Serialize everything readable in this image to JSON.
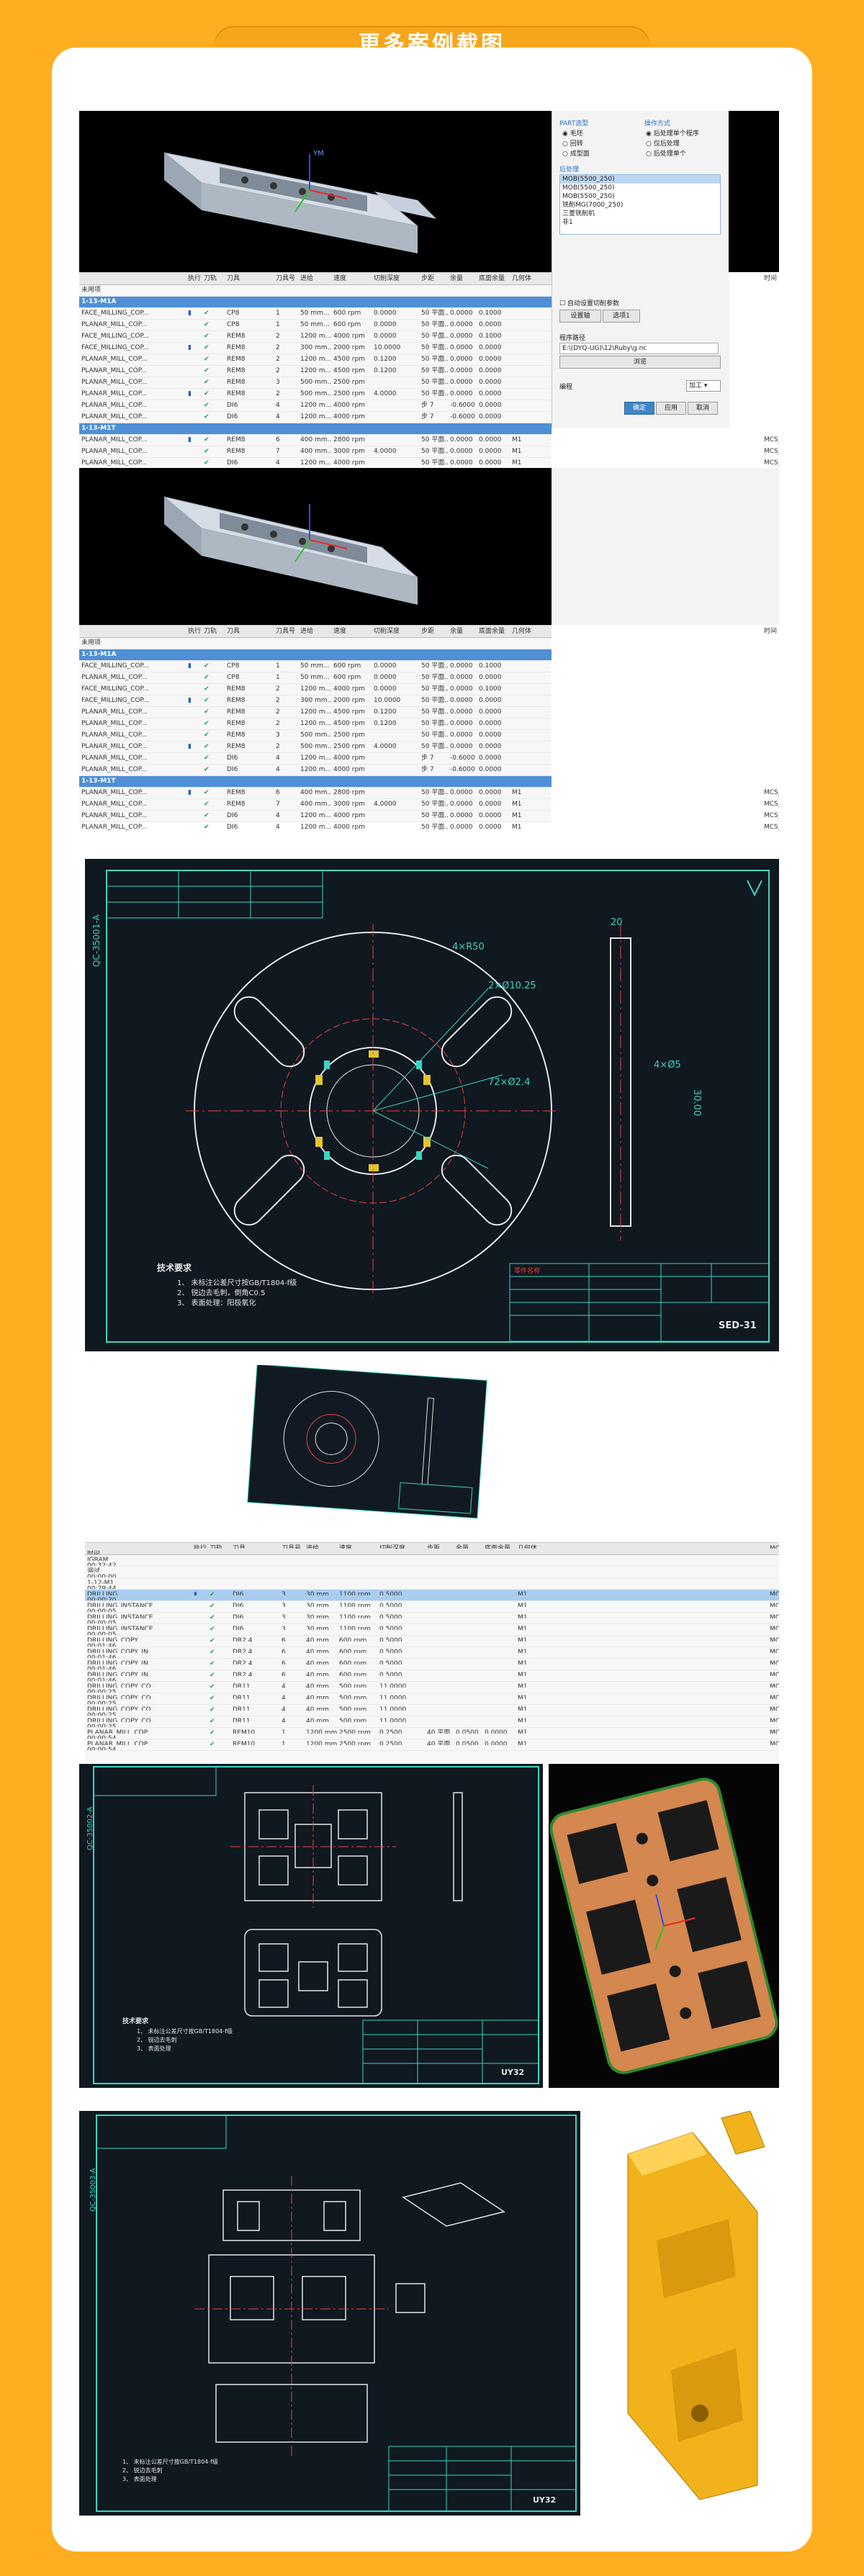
{
  "page": {
    "title": "更多案例截图"
  },
  "panel1": {
    "dialog": {
      "part_group": "PART选型",
      "part_options": [
        "毛坯",
        "回转",
        "成型面"
      ],
      "operate_group": "操作方式",
      "operate_options": [
        "后处理单个程序",
        "仅后处理",
        "后处理单个"
      ],
      "post_label": "后处理",
      "post_items": [
        "MOB(5500_250)",
        "MOB(5500_250)",
        "MOB(5500_250)",
        "铣削MG(7000_250)",
        "三菱铣削机",
        "非1"
      ],
      "auto_check": "自动设置切削参数",
      "buttons_small": [
        "设置轴",
        "选项1"
      ],
      "program_path_label": "程序路径",
      "program_path": "E:\\(DYQ-UG)\\12\\Ruby\\g.nc",
      "browse": "浏览",
      "mode_label": "编程",
      "mode_value": "加工",
      "confirm": "确定",
      "apply": "应用",
      "cancel": "取消"
    },
    "headers": [
      "",
      "执行",
      "刀轨",
      "刀具",
      "刀具号",
      "进给",
      "速度",
      "切削深度",
      "步距",
      "余量",
      "底面余量",
      "几何体",
      "时间"
    ],
    "rows": [
      {
        "name": "未用项",
        "type": "plain",
        "cols": [
          "",
          "",
          "",
          "",
          "",
          "",
          "",
          "",
          "",
          "",
          "",
          ""
        ]
      },
      {
        "name": "1-13-M1A",
        "type": "group",
        "cols": [
          "",
          "",
          "",
          "",
          "",
          "",
          "",
          "",
          "",
          "",
          "",
          ""
        ]
      },
      {
        "name": "FACE_MILLING_COP...",
        "type": "plain",
        "cols": [
          "▮",
          "✔",
          "CP8",
          "1",
          "50 mm...",
          "600 rpm",
          "0.0000",
          "50 平面...",
          "0.0000",
          "0.1000",
          "",
          ""
        ]
      },
      {
        "name": "PLANAR_MILL_COP...",
        "type": "plain",
        "cols": [
          "",
          "✔",
          "CP8",
          "1",
          "50 mm...",
          "600 rpm",
          "0.0000",
          "50 平面...",
          "0.0000",
          "0.0000",
          "",
          ""
        ]
      },
      {
        "name": "FACE_MILLING_COP...",
        "type": "plain",
        "cols": [
          "",
          "✔",
          "REM8",
          "2",
          "1200 m...",
          "4000 rpm",
          "0.0000",
          "50 平面...",
          "0.0000",
          "0.1000",
          "",
          ""
        ]
      },
      {
        "name": "FACE_MILLING_COP...",
        "type": "plain",
        "cols": [
          "▮",
          "✔",
          "REM8",
          "2",
          "300 mm...",
          "2000 rpm",
          "10.0000",
          "50 平面...",
          "0.0000",
          "0.0000",
          "",
          ""
        ]
      },
      {
        "name": "PLANAR_MILL_COP...",
        "type": "plain",
        "cols": [
          "",
          "✔",
          "REM8",
          "2",
          "1200 m...",
          "4500 rpm",
          "0.1200",
          "50 平面...",
          "0.0000",
          "0.0000",
          "",
          ""
        ]
      },
      {
        "name": "PLANAR_MILL_COP...",
        "type": "plain",
        "cols": [
          "",
          "✔",
          "REM8",
          "2",
          "1200 m...",
          "4500 rpm",
          "0.1200",
          "50 平面...",
          "0.0000",
          "0.0000",
          "",
          ""
        ]
      },
      {
        "name": "PLANAR_MILL_COP...",
        "type": "plain",
        "cols": [
          "",
          "✔",
          "REM8",
          "3",
          "500 mm...",
          "2500 rpm",
          "",
          "50 平面...",
          "0.0000",
          "0.0000",
          "",
          ""
        ]
      },
      {
        "name": "PLANAR_MILL_COP...",
        "type": "plain",
        "cols": [
          "▮",
          "✔",
          "REM8",
          "2",
          "500 mm...",
          "2500 rpm",
          "4.0000",
          "50 平面...",
          "0.0000",
          "0.0000",
          "",
          ""
        ]
      },
      {
        "name": "PLANAR_MILL_COP...",
        "type": "plain",
        "cols": [
          "",
          "✔",
          "DI6",
          "4",
          "1200 m...",
          "4000 rpm",
          "",
          "步 7",
          "-0.6000",
          "0.0000",
          "",
          ""
        ]
      },
      {
        "name": "PLANAR_MILL_COP...",
        "type": "plain",
        "cols": [
          "",
          "✔",
          "DI6",
          "4",
          "1200 m...",
          "4000 rpm",
          "",
          "步 7",
          "-0.6000",
          "0.0000",
          "",
          ""
        ]
      },
      {
        "name": "1-13-M1T",
        "type": "group",
        "cols": [
          "",
          "",
          "",
          "",
          "",
          "",
          "",
          "",
          "",
          "",
          "",
          ""
        ]
      },
      {
        "name": "PLANAR_MILL_COP...",
        "type": "plain",
        "cols": [
          "▮",
          "✔",
          "REM8",
          "6",
          "400 mm...",
          "2800 rpm",
          "",
          "50 平面...",
          "0.0000",
          "0.0000",
          "M1",
          "MCS_MILL"
        ]
      },
      {
        "name": "PLANAR_MILL_COP...",
        "type": "plain",
        "cols": [
          "",
          "✔",
          "REM8",
          "7",
          "400 mm...",
          "3000 rpm",
          "4.0000",
          "50 平面...",
          "0.0000",
          "0.0000",
          "M1",
          "MCS_MILL"
        ]
      },
      {
        "name": "PLANAR_MILL_COP...",
        "type": "plain",
        "cols": [
          "",
          "✔",
          "DI6",
          "4",
          "1200 m...",
          "4000 rpm",
          "",
          "50 平面...",
          "0.0000",
          "0.0000",
          "M1",
          "MCS_MILL"
        ]
      },
      {
        "name": "PLANAR_MILL_COP...",
        "type": "plain",
        "cols": [
          "",
          "✔",
          "DI6",
          "4",
          "1200 m...",
          "4000 rpm",
          "",
          "50 平面...",
          "0.0000",
          "0.0000",
          "M1",
          "MCS_MILL"
        ]
      }
    ]
  },
  "panel2": {
    "headers": [
      "",
      "执行",
      "刀轨",
      "刀具",
      "刀具号",
      "进给",
      "速度",
      "切削深度",
      "步距",
      "余量",
      "底面余量",
      "几何体",
      "MCS",
      "时间"
    ],
    "rows": [
      {
        "name": "IGRAM",
        "cols": [
          "",
          "",
          "",
          "",
          "",
          "",
          "",
          "",
          "",
          "",
          "",
          "",
          "00:32:42"
        ]
      },
      {
        "name": "调试",
        "cols": [
          "",
          "",
          "",
          "",
          "",
          "",
          "",
          "",
          "",
          "",
          "",
          "",
          "00:00:00"
        ]
      },
      {
        "name": "1-12-M1",
        "cols": [
          "",
          "",
          "",
          "",
          "",
          "",
          "",
          "",
          "",
          "",
          "",
          "",
          "00:29:44"
        ]
      },
      {
        "name": "DRILLING",
        "sel": true,
        "cols": [
          "▮",
          "✔",
          "DI6",
          "3",
          "30 mm...",
          "1100 rpm",
          "0.5000",
          "",
          "",
          "",
          "M1",
          "MCS_MILL",
          "00:00:20"
        ]
      },
      {
        "name": "DRILLING_INSTANCE",
        "cols": [
          "",
          "✔",
          "DI6",
          "3",
          "30 mm...",
          "1100 rpm",
          "0.5000",
          "",
          "",
          "",
          "M1",
          "MCS_MILL",
          "00:00:05"
        ]
      },
      {
        "name": "DRILLING_INSTANCE",
        "cols": [
          "",
          "✔",
          "DI6",
          "3",
          "30 mm...",
          "1100 rpm",
          "0.5000",
          "",
          "",
          "",
          "M1",
          "MCS_MILL",
          "00:00:05"
        ]
      },
      {
        "name": "DRILLING_INSTANCE",
        "cols": [
          "",
          "✔",
          "DI6",
          "3",
          "30 mm...",
          "1100 rpm",
          "0.5000",
          "",
          "",
          "",
          "M1",
          "MCS_MILL",
          "00:00:05"
        ]
      },
      {
        "name": "DRILLING_COPY",
        "cols": [
          "",
          "✔",
          "DR2.4",
          "6",
          "40 mm...",
          "600 rpm",
          "0.5000",
          "",
          "",
          "",
          "M1",
          "MCS_MILL",
          "00:01:46"
        ]
      },
      {
        "name": "DRILLING_COPY_IN...",
        "cols": [
          "",
          "✔",
          "DR2.4",
          "6",
          "40 mm...",
          "600 rpm",
          "0.5000",
          "",
          "",
          "",
          "M1",
          "MCS_MILL",
          "00:01:46"
        ]
      },
      {
        "name": "DRILLING_COPY_IN...",
        "cols": [
          "",
          "✔",
          "DR2.4",
          "6",
          "40 mm...",
          "600 rpm",
          "0.5000",
          "",
          "",
          "",
          "M1",
          "MCS_MILL",
          "00:01:46"
        ]
      },
      {
        "name": "DRILLING_COPY_IN...",
        "cols": [
          "",
          "✔",
          "DR2.4",
          "6",
          "40 mm...",
          "600 rpm",
          "0.5000",
          "",
          "",
          "",
          "M1",
          "MCS_MILL",
          "00:01:46"
        ]
      },
      {
        "name": "DRILLING_COPY_CO...",
        "cols": [
          "",
          "✔",
          "DR11",
          "4",
          "40 mm...",
          "500 rpm",
          "11.0000",
          "",
          "",
          "",
          "M1",
          "MCS_MILL",
          "00:00:25"
        ]
      },
      {
        "name": "DRILLING_COPY_CO...",
        "cols": [
          "",
          "✔",
          "DR11",
          "4",
          "40 mm...",
          "500 rpm",
          "11.0000",
          "",
          "",
          "",
          "M1",
          "MCS_MILL",
          "00:00:25"
        ]
      },
      {
        "name": "DRILLING_COPY_CO...",
        "cols": [
          "",
          "✔",
          "DR11",
          "4",
          "40 mm...",
          "500 rpm",
          "11.0000",
          "",
          "",
          "",
          "M1",
          "MCS_MILL",
          "00:00:25"
        ]
      },
      {
        "name": "DRILLING_COPY_CO...",
        "cols": [
          "",
          "✔",
          "DR11",
          "4",
          "40 mm...",
          "500 rpm",
          "11.0000",
          "",
          "",
          "",
          "M1",
          "MCS_MILL",
          "00:00:25"
        ]
      },
      {
        "name": "PLANAR_MILL_COP...",
        "cols": [
          "",
          "✔",
          "REM10",
          "1",
          "1200 mm...",
          "2500 rpm",
          "0.2500",
          "40 平面...",
          "0.0500",
          "0.0000",
          "M1",
          "MCS_MILL",
          "00:00:54"
        ]
      },
      {
        "name": "PLANAR_MILL_COP...",
        "cols": [
          "",
          "✔",
          "REM10",
          "1",
          "1200 mm...",
          "2500 rpm",
          "0.2500",
          "40 平面...",
          "0.0500",
          "0.0000",
          "M1",
          "MCS_MILL",
          "00:00:54"
        ]
      }
    ]
  },
  "cad1": {
    "vert_code": "QC-35001-A",
    "tech_title": "技术要求",
    "tech_lines": [
      "1、 未标注公差尺寸按GB/T1804-f级",
      "2、 锐边去毛刺，倒角C0.5",
      "3、 表面处理：阳极氧化"
    ],
    "dims": [
      "4×R50",
      "2×Ø10.25",
      "72×Ø2.4",
      "4×Ø5",
      "20",
      "30.00"
    ],
    "drawing_no": "SED-31",
    "title_block_header": "零件名称"
  },
  "cad2": {
    "vert_code": "QC-35002-A",
    "drawing_no": "UY32",
    "tech_title": "技术要求",
    "tech_lines": [
      "1、 未标注公差尺寸按GB/T1804-f级",
      "2、 锐边去毛刺",
      "3、 表面处理"
    ]
  },
  "cad3": {
    "vert_code": "QC-35003-A",
    "drawing_no": "UY32",
    "tech_lines": [
      "1、 未标注公差尺寸按GB/T1804-f级",
      "2、 锐边去毛刺",
      "3、 表面处理"
    ]
  },
  "colors": {
    "orange_bg": "#ffae22",
    "pill": "#f6a61c",
    "cad_bg": "#101820",
    "cad_line": "#e6e6e6",
    "cad_border": "#3ad6c0"
  }
}
